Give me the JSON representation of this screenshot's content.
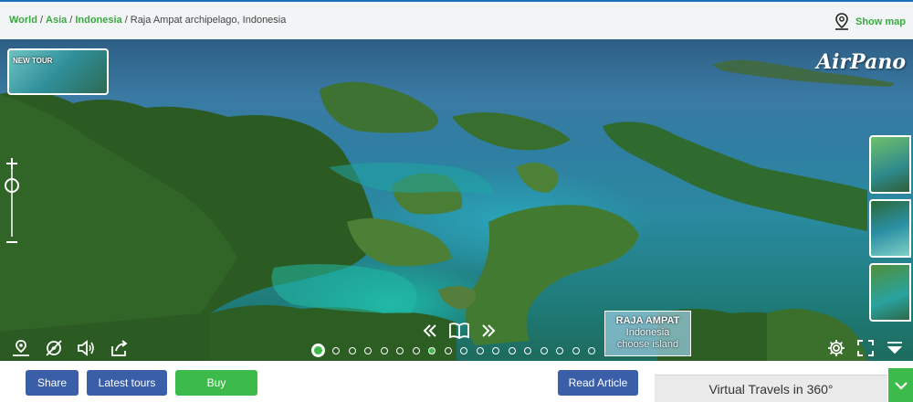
{
  "breadcrumb": {
    "items": [
      "World",
      "Asia",
      "Indonesia"
    ],
    "current": "Raja Ampat archipelago, Indonesia",
    "separator": "/"
  },
  "header": {
    "show_map_label": "Show map",
    "show_map_icon": "map-pin-icon"
  },
  "viewer": {
    "logo": "AirPano",
    "new_tour_label": "NEW TOUR",
    "island_card": {
      "title": "RAJA AMPAT",
      "subtitle": "Indonesia",
      "hint": "choose island"
    },
    "left_controls": [
      "location-pin-icon",
      "compass-off-icon",
      "sound-icon",
      "share-arrow-icon"
    ],
    "right_controls": [
      "gear-icon",
      "fullscreen-icon",
      "collapse-menu-icon"
    ],
    "nav": [
      "chevron-double-left-icon",
      "book-icon",
      "chevron-double-right-icon"
    ],
    "dots_count": 18,
    "active_dot": 0,
    "highlighted_dot": 7
  },
  "actions": {
    "share": "Share",
    "latest_tours": "Latest tours",
    "buy": "Buy",
    "read_article": "Read Article"
  },
  "footer": {
    "virtual_travels": "Virtual Travels in 360°"
  },
  "colors": {
    "link_green": "#3aa840",
    "button_blue": "#3a5ea8",
    "button_green": "#3cbb4a",
    "top_border": "#1e6fb8"
  }
}
